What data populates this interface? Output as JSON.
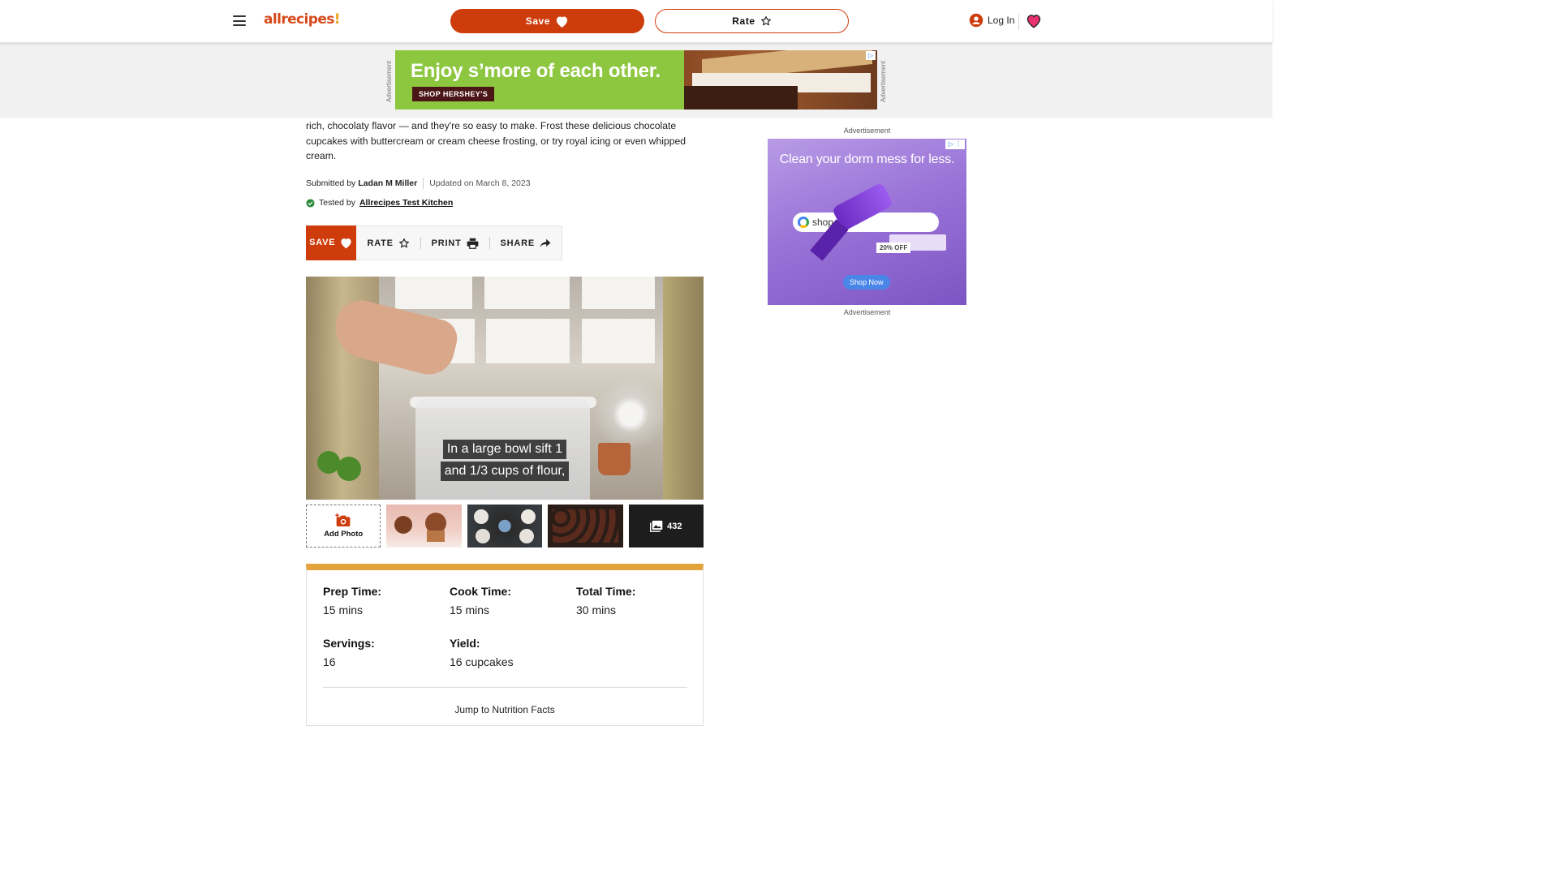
{
  "header": {
    "logo_text": "allrecipes",
    "logo_mark": "!",
    "save_label": "Save",
    "rate_label": "Rate",
    "login_label": "Log In",
    "brand_color": "#ce3c0c"
  },
  "top_ad": {
    "side_label": "Advertisement",
    "headline": "Enjoy s’more of each other.",
    "cta": "SHOP HERSHEY'S",
    "adchoice": "▷"
  },
  "recipe": {
    "description": "rich, chocolaty flavor — and they're so easy to make. Frost these delicious chocolate cupcakes with buttercream or cream cheese frosting, or try royal icing or even whipped cream.",
    "submitted_prefix": "Submitted by",
    "author": "Ladan M Miller",
    "updated": "Updated on March 8, 2023",
    "tested_prefix": "Tested by",
    "tested_by": "Allrecipes Test Kitchen"
  },
  "actions": {
    "save": "SAVE",
    "rate": "RATE",
    "print": "PRINT",
    "share": "SHARE"
  },
  "video": {
    "caption_line1": "In a large bowl sift 1",
    "caption_line2": "and 1/3 cups of flour,"
  },
  "gallery": {
    "add_photo": "Add Photo",
    "photo_count": "432"
  },
  "details": {
    "prep_label": "Prep Time:",
    "prep_value": "15 mins",
    "cook_label": "Cook Time:",
    "cook_value": "15 mins",
    "total_label": "Total Time:",
    "total_value": "30 mins",
    "servings_label": "Servings:",
    "servings_value": "16",
    "yield_label": "Yield:",
    "yield_value": "16 cupcakes",
    "jump_label": "Jump to Nutrition Facts",
    "accent_color": "#e3a23a"
  },
  "rail_ad": {
    "label_top": "Advertisement",
    "headline": "Clean your dorm mess for less.",
    "search_text": "shop",
    "tag": "20% OFF",
    "button": "Shop Now",
    "label_bottom": "Advertisement"
  }
}
